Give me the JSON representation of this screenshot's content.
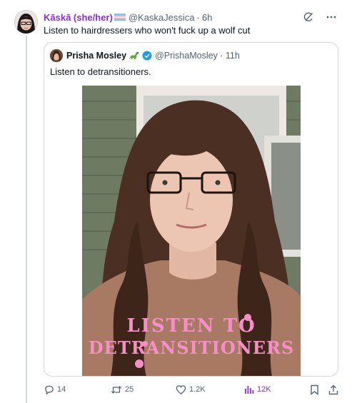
{
  "tweet": {
    "display_name": "Kāskā (she/her)",
    "handle": "@KaskaJessica",
    "time": "6h",
    "text": "Listen to hairdressers who won't fuck up a wolf cut",
    "flag_colors": [
      "#5bcefa",
      "#f5a9b8",
      "#ffffff",
      "#f5a9b8",
      "#5bcefa"
    ],
    "accent_color": "#8a2be2"
  },
  "quoted": {
    "display_name": "Prisha Mosley",
    "handle": "@PrishaMosley",
    "time": "11h",
    "text": "Listen to detransitioners.",
    "verified_color": "#1d9bf0",
    "image": {
      "shirt_lines": [
        "LISTEN TO",
        "DETRANSITIONERS"
      ],
      "shirt_color": "#a87a63",
      "print_color": "#f490c6"
    }
  },
  "actions": {
    "replies": "14",
    "reposts": "25",
    "likes": "1.2K",
    "views": "12K"
  },
  "icons": {
    "header": [
      "grok-icon",
      "more-icon"
    ],
    "actions": [
      "reply-icon",
      "repost-icon",
      "like-icon",
      "views-icon",
      "bookmark-icon",
      "share-icon"
    ]
  }
}
